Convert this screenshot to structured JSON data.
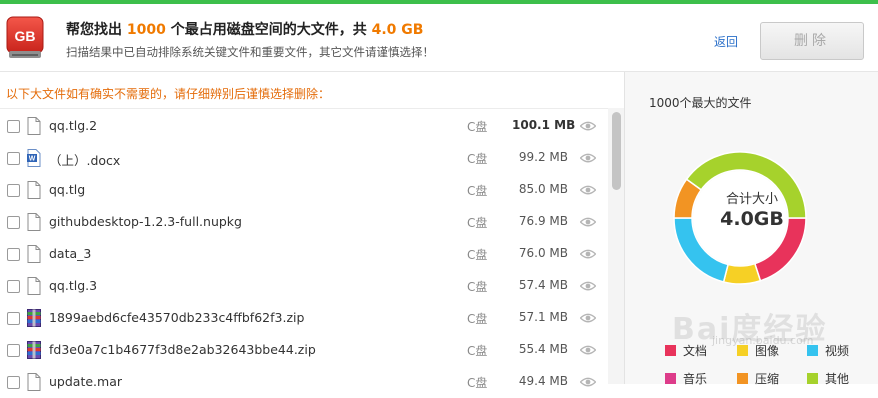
{
  "header": {
    "icon_text": "GB",
    "title_prefix": "帮您找出 ",
    "title_count": "1000",
    "title_middle": " 个最占用磁盘空间的大文件，共 ",
    "title_total": "4.0 GB",
    "subtitle": "扫描结果中已自动排除系统关键文件和重要文件，其它文件请谨慎选择！",
    "back_label": "返回",
    "delete_label": "删除"
  },
  "list": {
    "notice": "以下大文件如有确实不需要的，请仔细辨别后谨慎选择删除：",
    "rows": [
      {
        "name": "qq.tlg.2",
        "drive": "C盘",
        "size": "100.1 MB",
        "bold": true,
        "icon": "file-icon"
      },
      {
        "name": "（上）.docx",
        "drive": "C盘",
        "size": "99.2 MB",
        "bold": false,
        "icon": "word-doc-icon"
      },
      {
        "name": "qq.tlg",
        "drive": "C盘",
        "size": "85.0 MB",
        "bold": false,
        "icon": "file-icon"
      },
      {
        "name": "githubdesktop-1.2.3-full.nupkg",
        "drive": "C盘",
        "size": "76.9 MB",
        "bold": false,
        "icon": "file-icon"
      },
      {
        "name": "data_3",
        "drive": "C盘",
        "size": "76.0 MB",
        "bold": false,
        "icon": "file-icon"
      },
      {
        "name": "qq.tlg.3",
        "drive": "C盘",
        "size": "57.4 MB",
        "bold": false,
        "icon": "file-icon"
      },
      {
        "name": "1899aebd6cfe43570db233c4ffbf62f3.zip",
        "drive": "C盘",
        "size": "57.1 MB",
        "bold": false,
        "icon": "zip-archive-icon"
      },
      {
        "name": "fd3e0a7c1b4677f3d8e2ab32643bbe44.zip",
        "drive": "C盘",
        "size": "55.4 MB",
        "bold": false,
        "icon": "zip-archive-icon"
      },
      {
        "name": "update.mar",
        "drive": "C盘",
        "size": "49.4 MB",
        "bold": false,
        "icon": "file-icon"
      }
    ]
  },
  "chart_panel": {
    "title": "1000个最大的文件",
    "center_label": "合计大小",
    "center_value": "4.0GB"
  },
  "chart_data": {
    "type": "pie",
    "categories": [
      "文档",
      "图像",
      "视频",
      "音乐",
      "压缩",
      "其他"
    ],
    "values": [
      20,
      9,
      21,
      0,
      10,
      40
    ],
    "colors": [
      "#e8335b",
      "#f6d025",
      "#35c3ef",
      "#dd3c8a",
      "#f29423",
      "#a6d22c"
    ],
    "legend": [
      {
        "label": "文档",
        "color": "#e8335b"
      },
      {
        "label": "图像",
        "color": "#f6d025"
      },
      {
        "label": "视频",
        "color": "#35c3ef"
      },
      {
        "label": "音乐",
        "color": "#dd3c8a"
      },
      {
        "label": "压缩",
        "color": "#f29423"
      },
      {
        "label": "其他",
        "color": "#a6d22c"
      }
    ]
  },
  "watermark": {
    "main": "Bai度经验",
    "sub": "jingyan.baidu.com"
  }
}
